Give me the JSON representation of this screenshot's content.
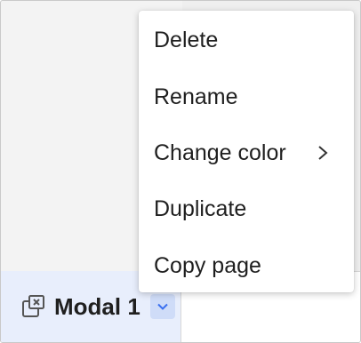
{
  "menu": {
    "items": [
      {
        "label": "Delete",
        "has_submenu": false
      },
      {
        "label": "Rename",
        "has_submenu": false
      },
      {
        "label": "Change color",
        "has_submenu": true
      },
      {
        "label": "Duplicate",
        "has_submenu": false
      },
      {
        "label": "Copy page",
        "has_submenu": false
      }
    ]
  },
  "tab": {
    "label": "Modal 1",
    "icon": "modal-page-icon",
    "dropdown_icon": "chevron-down-icon"
  },
  "colors": {
    "tab_background": "#e8eefc",
    "chevron_background": "#cfdcf8",
    "chevron_color": "#3a6ff0",
    "text": "#1f1f1f"
  }
}
